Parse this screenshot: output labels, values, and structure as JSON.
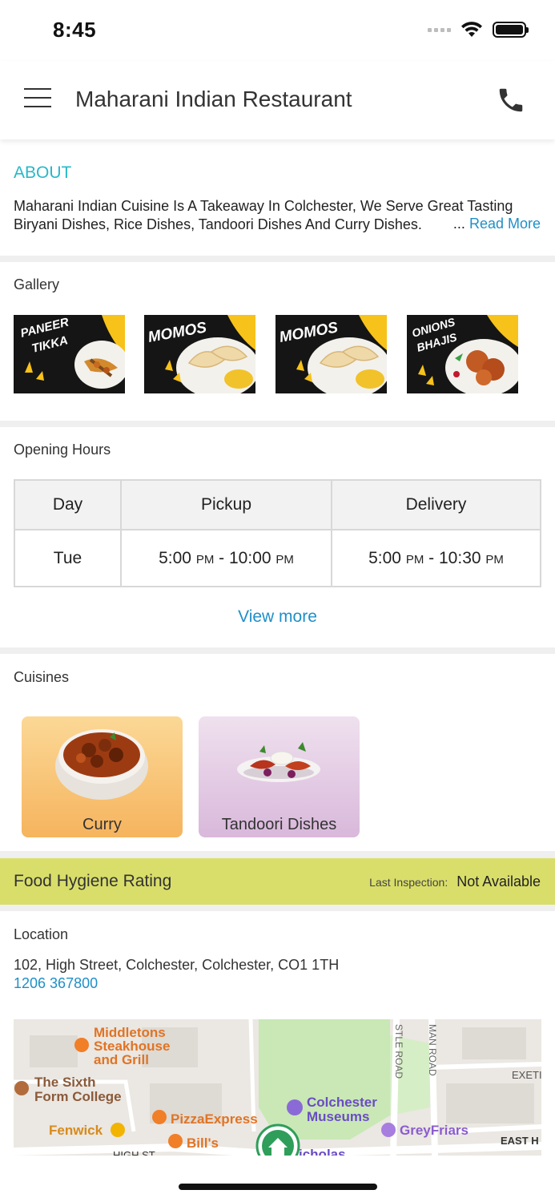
{
  "status": {
    "time": "8:45"
  },
  "header": {
    "title": "Maharani Indian Restaurant",
    "menu_icon": "hamburger-menu-icon",
    "phone_icon": "phone-icon"
  },
  "about": {
    "title": "ABOUT",
    "text": "Maharani Indian Cuisine Is A Takeaway In Colchester, We Serve Great Tasting Biryani Dishes, Rice Dishes, Tandoori Dishes And Curry Dishes.",
    "ellipsis": "...",
    "read_more": "Read More"
  },
  "gallery": {
    "title": "Gallery",
    "items": [
      {
        "caption": "PANEER",
        "caption2": "TIKKA"
      },
      {
        "caption": "MOMOS",
        "caption2": ""
      },
      {
        "caption": "MOMOS",
        "caption2": ""
      },
      {
        "caption": "ONIONS",
        "caption2": "BHAJIS"
      }
    ]
  },
  "opening_hours": {
    "title": "Opening Hours",
    "headers": [
      "Day",
      "Pickup",
      "Delivery"
    ],
    "row": {
      "day": "Tue",
      "pickup_start": "5:00",
      "pickup_start_ampm": "PM",
      "pickup_end": "10:00",
      "pickup_end_ampm": "PM",
      "delivery_start": "5:00",
      "delivery_start_ampm": "PM",
      "delivery_end": "10:30",
      "delivery_end_ampm": "PM",
      "dash": "-"
    },
    "view_more": "View more"
  },
  "cuisines": {
    "title": "Cuisines",
    "items": [
      {
        "label": "Curry",
        "color_top": "#fbd896",
        "color_bottom": "#f6b45e"
      },
      {
        "label": "Tandoori Dishes",
        "color_top": "#efe1ee",
        "color_bottom": "#d9b8db"
      }
    ]
  },
  "hygiene": {
    "title": "Food Hygiene Rating",
    "last_inspection_label": "Last Inspection:",
    "last_inspection_value": "Not Available",
    "color": "#d9de6a"
  },
  "location": {
    "title": "Location",
    "address": "102, High Street, Colchester, Colchester, CO1 1TH",
    "phone": "1206 367800",
    "map_labels": {
      "middletons_1": "Middletons",
      "middletons_2": "Steakhouse",
      "middletons_3": "and Grill",
      "sixth_1": "The Sixth",
      "sixth_2": "Form College",
      "fenwick": "Fenwick",
      "pizza": "PizzaExpress",
      "bills": "Bill's",
      "museum_1": "Colchester",
      "museum_2": "Museums",
      "greyfriars": "GreyFriars",
      "castle_road": "STLE ROAD",
      "man_road": "MAN ROAD",
      "exeter": "EXETI",
      "east_hill": "EAST H",
      "high_st": "HIGH ST",
      "nicholas": "icholas"
    }
  },
  "colors": {
    "accent": "#28b8c8",
    "link": "#1f8fc8",
    "separator": "#efefef"
  }
}
